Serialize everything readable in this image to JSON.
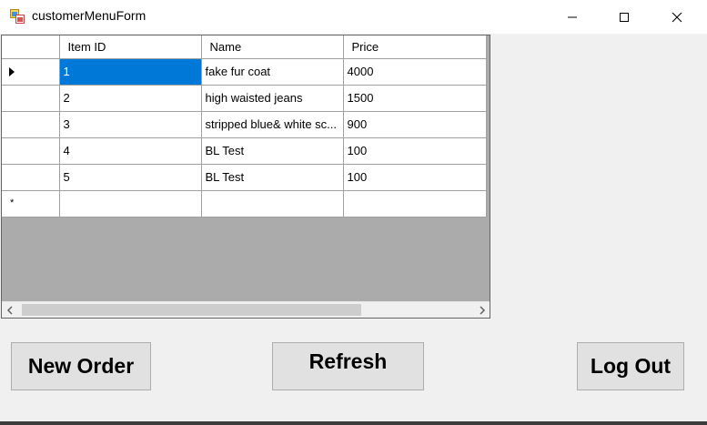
{
  "window": {
    "title": "customerMenuForm"
  },
  "grid": {
    "columns": [
      "Item ID",
      "Name",
      "Price"
    ],
    "rows": [
      {
        "id": "1",
        "name": "fake fur coat",
        "price": "4000"
      },
      {
        "id": "2",
        "name": "high waisted jeans",
        "price": "1500"
      },
      {
        "id": "3",
        "name": "stripped blue& white sc...",
        "price": "900"
      },
      {
        "id": "4",
        "name": "BL Test",
        "price": "100"
      },
      {
        "id": "5",
        "name": "BL Test",
        "price": "100"
      }
    ],
    "selected_row": 0,
    "new_row_marker": "*"
  },
  "buttons": {
    "new_order": "New Order",
    "refresh": "Refresh",
    "log_out": "Log Out"
  },
  "icons": {
    "app": "form-app-icon",
    "minimize": "minimize-icon",
    "maximize": "maximize-icon",
    "close": "close-icon",
    "row_selector": "row-selector-arrow-icon",
    "scroll_left": "chevron-left-icon",
    "scroll_right": "chevron-right-icon"
  },
  "colors": {
    "selection": "#0078d7",
    "grid_background": "#ababab",
    "window_background": "#f0f0f0"
  }
}
